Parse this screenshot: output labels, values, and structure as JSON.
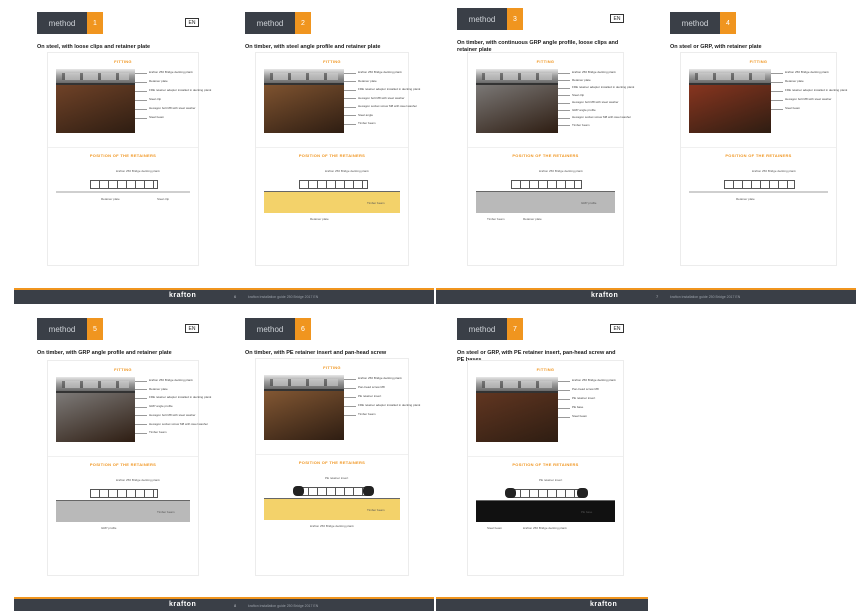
{
  "brand": "krafton",
  "badge_label": "method",
  "lang": "EN",
  "sections": {
    "fitting": "FITTING",
    "position": "POSITION OF THE RETAINERS"
  },
  "pages": [
    {
      "num": "1",
      "title": "On steel, with loose clips and retainer plate",
      "show_en": true,
      "callouts": [
        "krafton 250 Bridge decking plank",
        "Retainer plate",
        "FRE retainer adaptor installed in decking plank",
        "Steel clip",
        "Hexagon bolt M8 with steel washer",
        "Steel beam"
      ],
      "pos_labels": [
        "krafton 250 Bridge decking plank",
        "Retainer plate",
        "Steel clip"
      ],
      "colors": {
        "photo": "#7d4a2c",
        "ground": "#cfcfcf"
      }
    },
    {
      "num": "2",
      "title": "On timber, with steel angle profile and retainer plate",
      "show_en": false,
      "callouts": [
        "krafton 250 Bridge decking plank",
        "Retainer plate",
        "FRE retainer adaptor installed in decking plank",
        "Hexagon bolt M8 with steel washer",
        "Hexagon socket screw M8 with steel washer",
        "Steel angle",
        "Timber beam"
      ],
      "pos_labels": [
        "krafton 250 Bridge decking plank",
        "Retainer plate",
        "Timber beam"
      ],
      "colors": {
        "photo": "#8f5e36",
        "ground": "#f3d26a"
      }
    },
    {
      "num": "3",
      "title": "On timber, with continuous GRP angle profile, loose clips and retainer plate",
      "show_en": true,
      "callouts": [
        "krafton 250 Bridge decking plank",
        "Retainer plate",
        "FRE retainer adaptor installed in decking plank",
        "Steel clip",
        "Hexagon bolt M8 with steel washer",
        "GRP angle profile",
        "Hexagon socket screw M8 with steel washer",
        "Timber beam"
      ],
      "pos_labels": [
        "krafton 250 Bridge decking plank",
        "Retainer plate",
        "GRP profile",
        "Timber beam"
      ],
      "colors": {
        "photo": "#8a8a8a",
        "ground": "#b9b9b9"
      }
    },
    {
      "num": "4",
      "title": "On steel or GRP, with retainer plate",
      "show_en": false,
      "callouts": [
        "krafton 250 Bridge decking plank",
        "Retainer plate",
        "FRE retainer adaptor installed in decking plank",
        "Hexagon bolt M8 with steel washer",
        "Steel beam"
      ],
      "pos_labels": [
        "krafton 250 Bridge decking plank",
        "Retainer plate"
      ],
      "colors": {
        "photo": "#9a3a22",
        "ground": "#cfcfcf"
      }
    },
    {
      "num": "5",
      "title": "On timber, with GRP angle profile and retainer plate",
      "show_en": true,
      "callouts": [
        "krafton 250 Bridge decking plank",
        "Retainer plate",
        "FRE retainer adaptor installed in decking plank",
        "GRP angle profile",
        "Hexagon bolt M8 with steel washer",
        "Hexagon socket screw M8 with steel washer",
        "Timber beam"
      ],
      "pos_labels": [
        "krafton 250 Bridge decking plank",
        "GRP profile",
        "Timber beam"
      ],
      "colors": {
        "photo": "#8d8d8d",
        "ground": "#b9b9b9"
      }
    },
    {
      "num": "6",
      "title": "On timber, with PE retainer insert and pan-head screw",
      "show_en": false,
      "callouts": [
        "krafton 250 Bridge decking plank",
        "Pan-head screw M8",
        "PE retainer insert",
        "FRE retainer adaptor installed in decking plank",
        "Timber beam"
      ],
      "pos_labels": [
        "PE retainer insert",
        "krafton 250 Bridge decking plank",
        "Timber beam"
      ],
      "colors": {
        "photo": "#93633a",
        "ground": "#f3d26a"
      }
    },
    {
      "num": "7",
      "title": "On steel or GRP, with PE retainer insert, pan-head screw and PE bases",
      "show_en": true,
      "callouts": [
        "krafton 250 Bridge decking plank",
        "Pan-head screw M8",
        "PE retainer insert",
        "PE base",
        "Steel beam"
      ],
      "pos_labels": [
        "PE retainer insert",
        "krafton 250 Bridge decking plank",
        "PE base",
        "Steel beam"
      ],
      "colors": {
        "photo": "#6b3b24",
        "ground": "#111111"
      }
    }
  ],
  "footers": [
    {
      "page": "6",
      "text": "krafton installation guide 250 Bridge 2017 EN"
    },
    {
      "page": "7",
      "text": "krafton installation guide 250 Bridge 2017 EN"
    },
    {
      "page": "8",
      "text": "krafton installation guide 250 Bridge 2017 EN"
    },
    {
      "page": "9",
      "text": "krafton installation guide 250 Bridge 2017 EN"
    }
  ],
  "accent": "#f0951f",
  "dark": "#3a3f47"
}
